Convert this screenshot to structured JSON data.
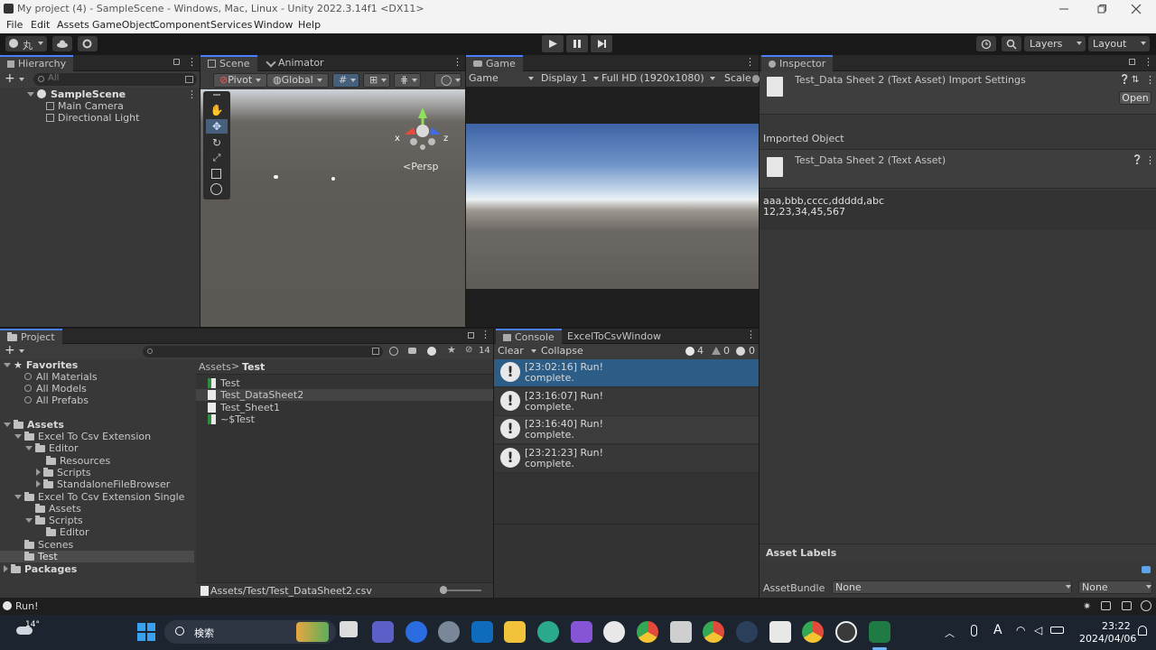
{
  "window": {
    "title": "My project (4) - SampleScene - Windows, Mac, Linux - Unity 2022.3.14f1 <DX11>"
  },
  "menu": [
    "File",
    "Edit",
    "Assets",
    "GameObject",
    "Component",
    "Services",
    "Window",
    "Help"
  ],
  "toolbar": {
    "account_label": "丸",
    "layers_label": "Layers",
    "layout_label": "Layout"
  },
  "hierarchy": {
    "tab": "Hierarchy",
    "search_placeholder": "All",
    "scene_name": "SampleScene",
    "items": [
      "Main Camera",
      "Directional Light"
    ]
  },
  "scene": {
    "tabs": [
      "Scene",
      "Animator"
    ],
    "pivot_label": "Pivot",
    "global_label": "Global",
    "persp_label": "<Persp",
    "gizmo_x": "x",
    "gizmo_z": "z"
  },
  "game": {
    "tab": "Game",
    "mode": "Game",
    "display": "Display 1",
    "resolution": "Full HD (1920x1080)",
    "scale_label": "Scale"
  },
  "inspector": {
    "tab": "Inspector",
    "title": "Test_Data Sheet 2 (Text Asset) Import Settings",
    "open_button": "Open",
    "imported_object_label": "Imported Object",
    "asset_title": "Test_Data Sheet 2 (Text Asset)",
    "content_line1": "aaa,bbb,cccc,ddddd,abc",
    "content_line2": "12,23,34,45,567",
    "asset_labels": "Asset Labels",
    "assetbundle_label": "AssetBundle",
    "assetbundle_value": "None",
    "assetbundle_variant": "None"
  },
  "project": {
    "tab": "Project",
    "hidden_count": "14",
    "favorites": {
      "label": "Favorites",
      "items": [
        "All Materials",
        "All Models",
        "All Prefabs"
      ]
    },
    "assets_label": "Assets",
    "tree": [
      {
        "label": "Excel To Csv Extension",
        "depth": 1,
        "expander": "open"
      },
      {
        "label": "Editor",
        "depth": 2,
        "expander": "open"
      },
      {
        "label": "Resources",
        "depth": 3,
        "expander": "none"
      },
      {
        "label": "Scripts",
        "depth": 3,
        "expander": "closed"
      },
      {
        "label": "StandaloneFileBrowser",
        "depth": 3,
        "expander": "closed"
      },
      {
        "label": "Excel To Csv Extension Single",
        "depth": 1,
        "expander": "open"
      },
      {
        "label": "Assets",
        "depth": 2,
        "expander": "none"
      },
      {
        "label": "Scripts",
        "depth": 2,
        "expander": "open"
      },
      {
        "label": "Editor",
        "depth": 3,
        "expander": "none"
      },
      {
        "label": "Scenes",
        "depth": 1,
        "expander": "none"
      },
      {
        "label": "Test",
        "depth": 1,
        "expander": "none",
        "selected": true
      }
    ],
    "packages_label": "Packages",
    "breadcrumb": [
      "Assets",
      "Test"
    ],
    "files": [
      {
        "name": "Test",
        "kind": "excel"
      },
      {
        "name": "Test_DataSheet2",
        "kind": "text",
        "selected": true
      },
      {
        "name": "Test_Sheet1",
        "kind": "text"
      },
      {
        "name": "~$Test",
        "kind": "excel"
      }
    ],
    "selected_path": "Assets/Test/Test_DataSheet2.csv"
  },
  "console": {
    "tabs": [
      "Console",
      "ExcelToCsvWindow"
    ],
    "clear_label": "Clear",
    "collapse_label": "Collapse",
    "info_count": "4",
    "warn_count": "0",
    "error_count": "0",
    "logs": [
      {
        "line1": "[23:02:16] Run!",
        "line2": "complete.",
        "selected": true
      },
      {
        "line1": "[23:16:07] Run!",
        "line2": "complete."
      },
      {
        "line1": "[23:16:40] Run!",
        "line2": "complete."
      },
      {
        "line1": "[23:21:23] Run!",
        "line2": "complete."
      }
    ]
  },
  "status_bar": {
    "message": "Run!"
  },
  "taskbar": {
    "temperature": "14°",
    "search_label": "検索",
    "time": "23:22",
    "date": "2024/04/06",
    "ime_label": "A"
  },
  "colors": {
    "accent_tab": "#4c7fff",
    "selection": "#2c5d87",
    "taskbar_bg": "#1c2430"
  }
}
